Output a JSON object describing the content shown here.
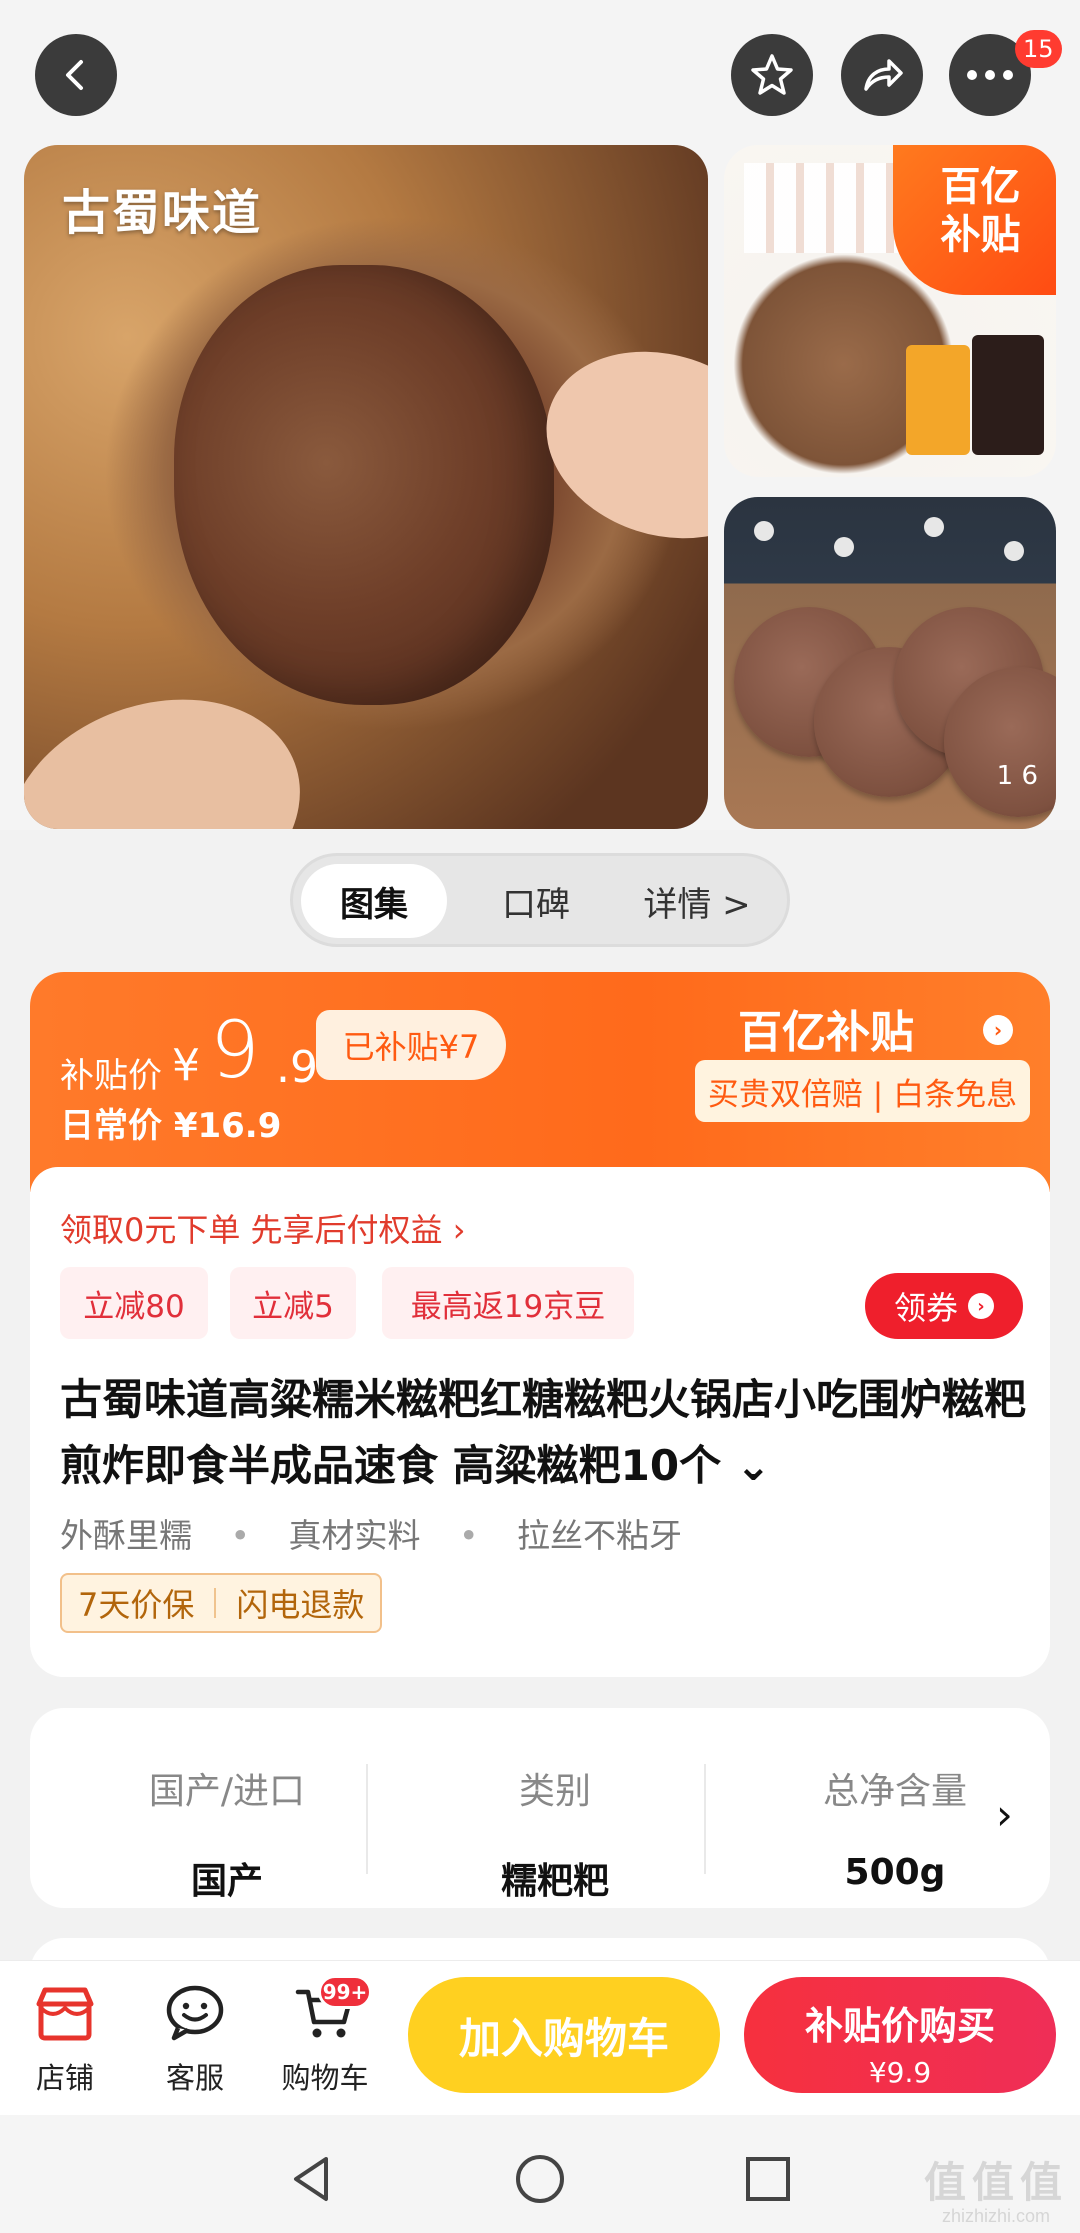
{
  "header": {
    "more_badge": "15"
  },
  "gallery": {
    "brand_overlay": "古蜀味道",
    "subsidy_badge_line1": "百亿",
    "subsidy_badge_line2": "补贴",
    "image_counter": "1 6"
  },
  "tabs": [
    "图集",
    "口碑",
    "详情 >"
  ],
  "price": {
    "label": "补贴价",
    "currency": "¥",
    "integer": "9",
    "decimal": ".9",
    "subsidy_chip": "已补贴¥7",
    "daily_price": "日常价 ¥16.9",
    "brand_badge": "百亿补贴",
    "guarantee": "买贵双倍赔 | 白条免息"
  },
  "promo": {
    "line": "领取0元下单 先享后付权益 ›",
    "chips": [
      "立减80",
      "立减5",
      "最高返19京豆"
    ],
    "coupon_label": "领券",
    "coupon_arrow": "›"
  },
  "product": {
    "title": "古蜀味道高粱糯米糍粑红糖糍粑火锅店小吃围炉糍粑煎炸即食半成品速食 高粱糍粑10个 ⌄",
    "features": [
      "外酥里糯",
      "真材实料",
      "拉丝不粘牙"
    ],
    "feature_dot": "•",
    "services": [
      "7天价保",
      "闪电退款"
    ]
  },
  "specs": [
    {
      "key": "国产/进口",
      "value": "国产"
    },
    {
      "key": "类别",
      "value": "糯粑粑"
    },
    {
      "key": "总净含量",
      "value": "500g"
    }
  ],
  "spec_arrow": "›",
  "bottom_bar": {
    "store": "店铺",
    "service": "客服",
    "cart": "购物车",
    "cart_badge": "99+",
    "add_to_cart": "加入购物车",
    "buy_line1": "补贴价购买",
    "buy_line2": "¥9.9"
  },
  "watermark": {
    "line1": "值值值",
    "line2": "zhizhizhi.com"
  },
  "colors": {
    "accent_orange": "#ff6a1b",
    "accent_red": "#ef1f2c",
    "cart_yellow": "#ffd020"
  }
}
